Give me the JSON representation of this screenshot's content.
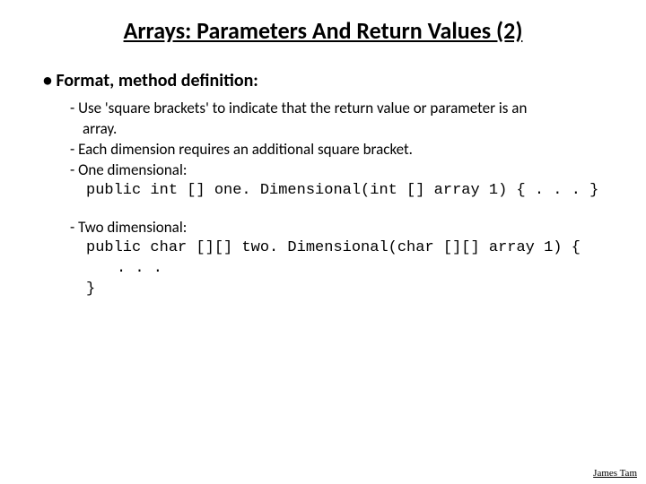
{
  "title": "Arrays: Parameters And Return Values (2)",
  "mainBullet": "Format, method definition:",
  "d1": "Use 'square brackets' to indicate that the return value or parameter is an",
  "d1b": "array.",
  "d2": "Each dimension requires an additional square bracket.",
  "d3": "One dimensional:",
  "code1": "public int [] one. Dimensional(int [] array 1) { . . . }",
  "d4": "Two dimensional:",
  "code2a": "public char [][] two. Dimensional(char [][] array 1) {",
  "code2b": ". . .",
  "code2c": "}",
  "footer": "James Tam"
}
